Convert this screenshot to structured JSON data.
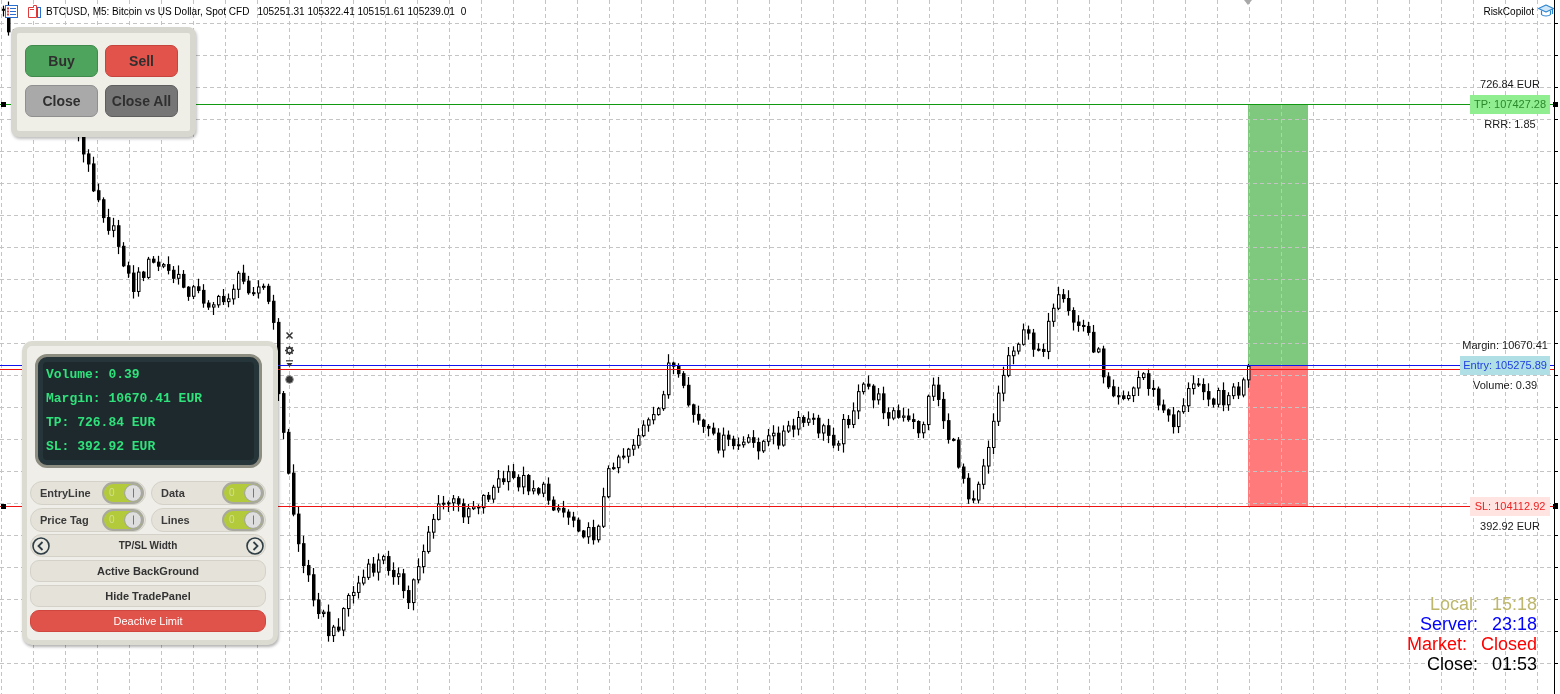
{
  "chart_header": {
    "title": "BTCUSD, M5: Bitcoin vs US Dollar, Spot CFD",
    "prices": "105251.31 105322.41 105151.61 105239.01",
    "volume": "0"
  },
  "brand": {
    "label": "RiskCopilot"
  },
  "trade_panel": {
    "buttons": [
      {
        "label": "Buy",
        "kind": "buy"
      },
      {
        "label": "Sell",
        "kind": "sell"
      },
      {
        "label": "Close",
        "kind": "close"
      },
      {
        "label": "Close All",
        "kind": "close_all"
      }
    ]
  },
  "info_panel": {
    "display_lines": [
      "Volume: 0.39",
      "Margin: 10670.41 EUR",
      "TP: 726.84 EUR",
      "SL: 392.92 EUR"
    ],
    "toggles": [
      {
        "label": "EntryLine",
        "on": true,
        "switch_text": "0"
      },
      {
        "label": "Data",
        "on": true,
        "switch_text": "0"
      },
      {
        "label": "Price Tag",
        "on": true,
        "switch_text": "0"
      },
      {
        "label": "Lines",
        "on": true,
        "switch_text": "0"
      }
    ],
    "stepper": {
      "label": "TP/SL Width"
    },
    "buttons": [
      {
        "label": "Active BackGround",
        "kind": "default"
      },
      {
        "label": "Hide TradePanel",
        "kind": "default"
      },
      {
        "label": "Deactive Limit",
        "kind": "danger"
      }
    ]
  },
  "price_levels": [
    {
      "kind": "take_profit",
      "label": "TP: 107427.28",
      "above": "726.84 EUR",
      "below": "RRR: 1.85"
    },
    {
      "kind": "entry",
      "label": "Entry: 105275.89",
      "above": "Margin: 10670.41",
      "below": "Volume: 0.39"
    },
    {
      "kind": "stop_loss",
      "label": "SL: 104112.92",
      "below": "392.92 EUR"
    }
  ],
  "clock": [
    {
      "label": "Local:",
      "value": "15:18",
      "color": "#bdb76b"
    },
    {
      "label": "Server:",
      "value": "23:18",
      "color": "#0000ff"
    },
    {
      "label": "Market:",
      "value": "Closed",
      "color": "#ff0000"
    },
    {
      "label": "Close:",
      "value": "01:53",
      "color": "#000000"
    }
  ]
}
